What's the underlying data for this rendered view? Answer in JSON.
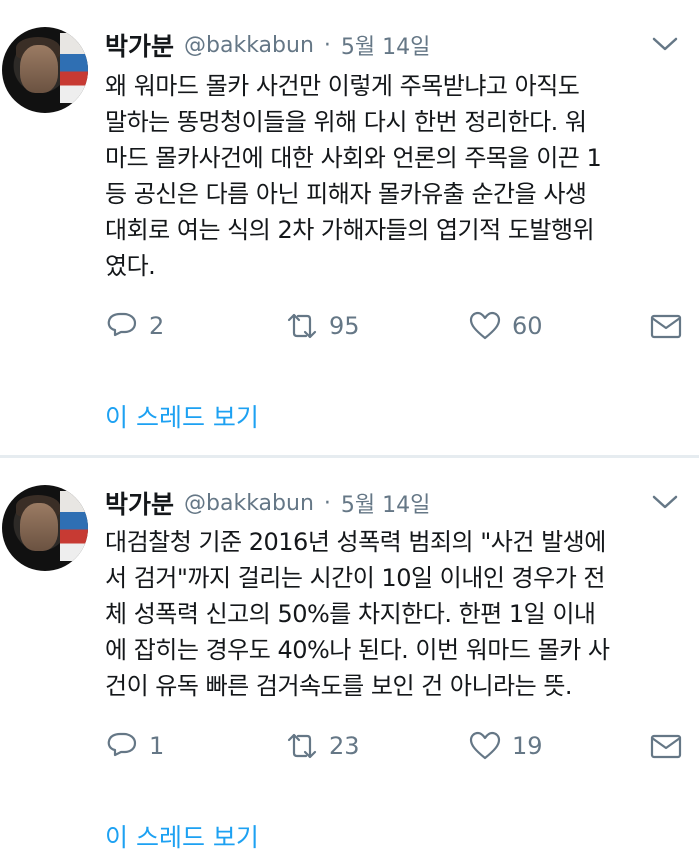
{
  "tweets": [
    {
      "author": "박가분",
      "handle": "@bakkabun",
      "separator": "·",
      "date": "5월 14일",
      "text": "왜 워마드 몰카 사건만 이렇게 주목받냐고 아직도\n말하는 똥멍청이들을 위해 다시 한번 정리한다. 워\n마드 몰카사건에 대한 사회와 언론의 주목을 이끈 1\n등 공신은 다름 아닌 피해자 몰카유출 순간을 사생\n대회로 여는 식의 2차 가해자들의 엽기적 도발행위\n였다.",
      "replies": "2",
      "retweets": "95",
      "likes": "60",
      "thread_label": "이 스레드 보기"
    },
    {
      "author": "박가분",
      "handle": "@bakkabun",
      "separator": "·",
      "date": "5월 14일",
      "text": "대검찰청 기준 2016년 성폭력 범죄의 \"사건 발생에\n서 검거\"까지 걸리는 시간이 10일 이내인 경우가 전\n체 성폭력 신고의 50%를 차지한다. 한편 1일 이내\n에 잡히는 경우도 40%나 된다. 이번 워마드 몰카 사\n건이 유독 빠른 검거속도를 보인 건 아니라는 뜻.",
      "replies": "1",
      "retweets": "23",
      "likes": "19",
      "thread_label": "이 스레드 보기"
    }
  ],
  "icons": {
    "reply": "reply-icon",
    "retweet": "retweet-icon",
    "like": "heart-icon",
    "dm": "envelope-icon",
    "menu": "chevron-down-icon"
  },
  "colors": {
    "link": "#1da1f2",
    "muted": "#657786",
    "text": "#14171a"
  }
}
